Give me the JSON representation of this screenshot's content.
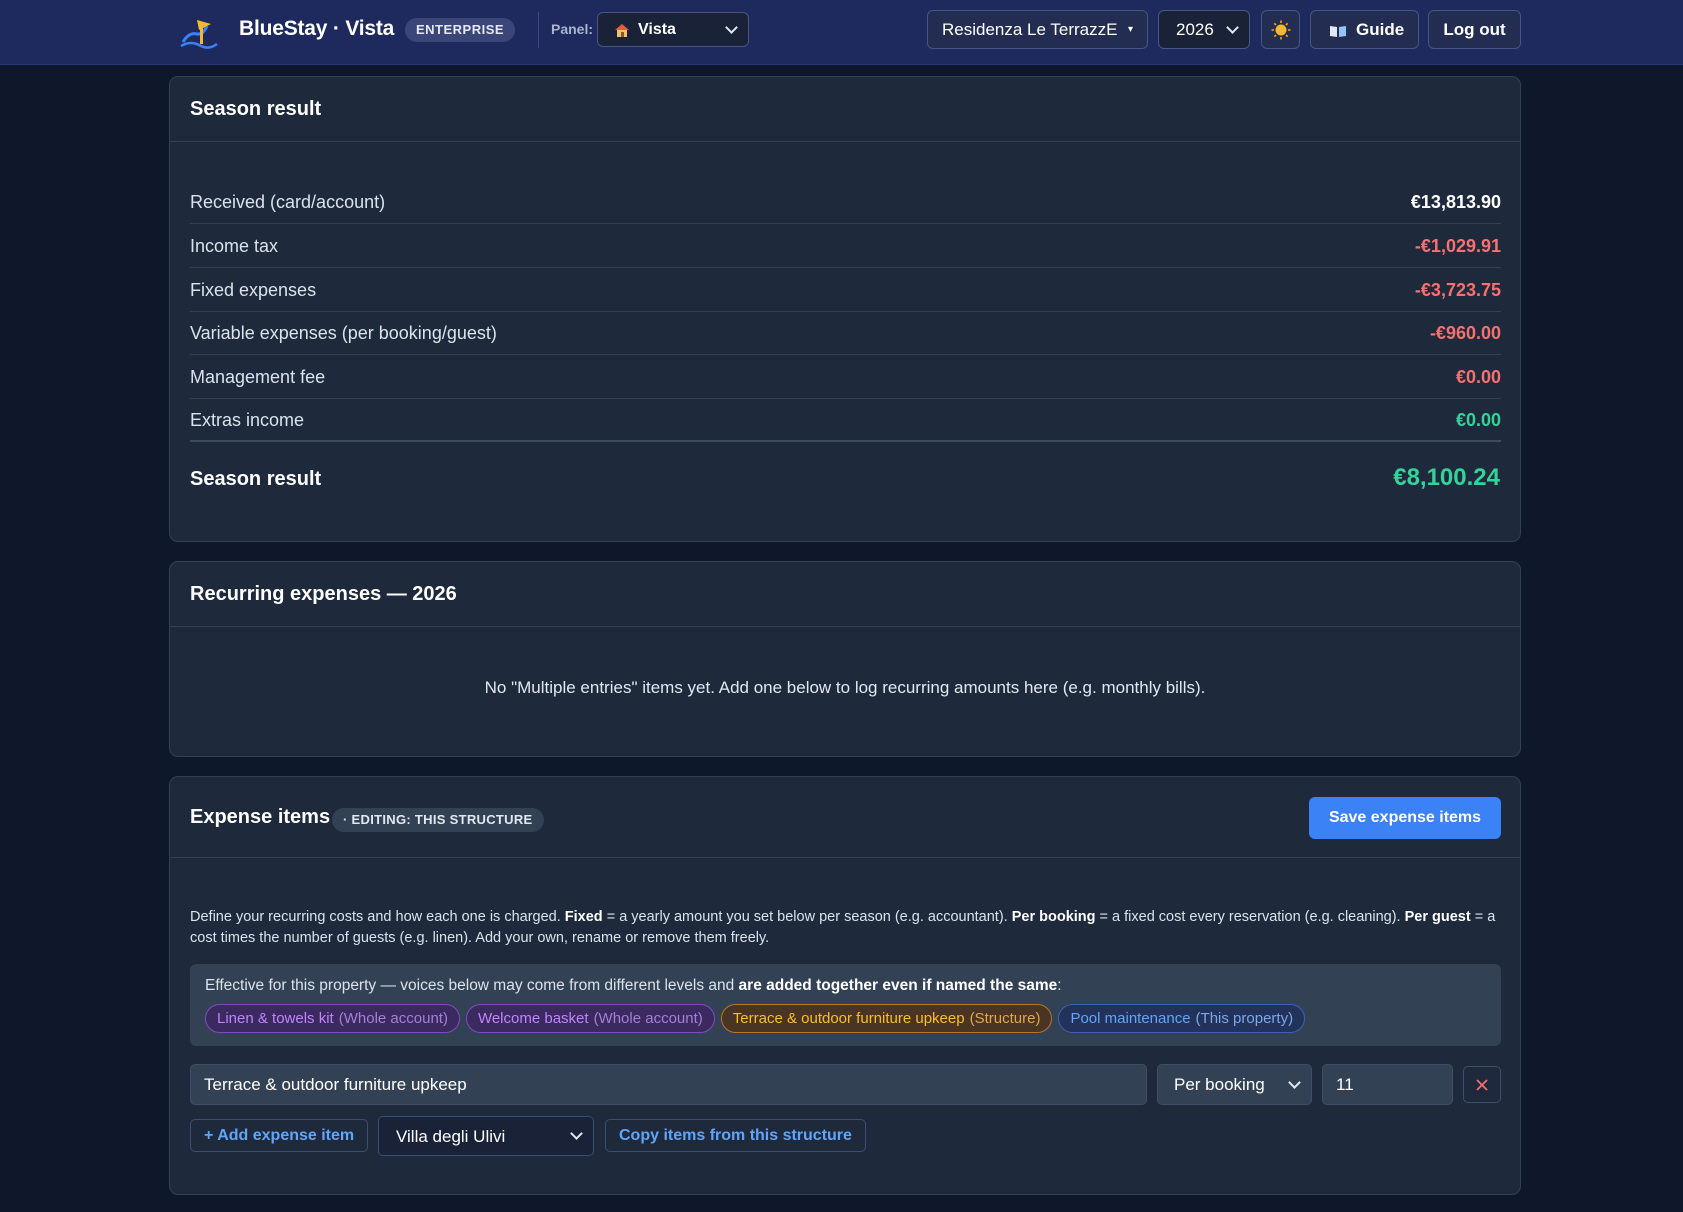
{
  "header": {
    "brand": "BlueStay · Vista",
    "edition_badge": "ENTERPRISE",
    "panel_label": "Panel:",
    "panel_value": "Vista",
    "property": "Residenza Le TerrazzE",
    "year": "2026",
    "guide_label": "Guide",
    "logout_label": "Log out"
  },
  "season": {
    "title": "Season result",
    "rows": [
      {
        "label": "Received (card/account)",
        "amount": "€13,813.90"
      },
      {
        "label": "Income tax",
        "amount": "-€1,029.91"
      },
      {
        "label": "Fixed expenses",
        "amount": "-€3,723.75"
      },
      {
        "label": "Variable expenses (per booking/guest)",
        "amount": "-€960.00"
      },
      {
        "label": "Management fee",
        "amount": "€0.00"
      },
      {
        "label": "Extras income",
        "amount": "€0.00"
      }
    ],
    "total_label": "Season result",
    "total_amount": "€8,100.24"
  },
  "recurring": {
    "title": "Recurring expenses — 2026",
    "empty_text": "No \"Multiple entries\" items yet. Add one below to log recurring amounts here (e.g. monthly bills)."
  },
  "expenses": {
    "title": "Expense items",
    "editing_badge": "· EDITING: THIS STRUCTURE",
    "save_label": "Save expense items",
    "desc": {
      "p1": "Define your recurring costs and how each one is charged. ",
      "fixed": "Fixed",
      "p2": " = a yearly amount you set below per season (e.g. accountant). ",
      "per_booking": "Per booking",
      "p3": " = a fixed cost every reservation (e.g. cleaning). ",
      "per_guest": "Per guest",
      "p4": " = a cost times the number of guests (e.g. linen). Add your own, rename or remove them freely."
    },
    "effective": {
      "intro": "Effective for this property — voices below may come from different levels and ",
      "intro_bold": "are added together even if named the same",
      "intro_end": ":",
      "pills": [
        {
          "name": "Linen & towels kit",
          "level": "(Whole account)"
        },
        {
          "name": "Welcome basket",
          "level": "(Whole account)"
        },
        {
          "name": "Terrace & outdoor furniture upkeep",
          "level": "(Structure)"
        },
        {
          "name": "Pool maintenance",
          "level": "(This property)"
        }
      ]
    },
    "item": {
      "name": "Terrace & outdoor furniture upkeep",
      "mode": "Per booking",
      "amount": "11"
    },
    "add_label": "+ Add expense item",
    "source_structure": "Villa degli Ulivi",
    "copy_label": "Copy items from this structure"
  },
  "colors": {
    "topbar": "#1e2a5e",
    "background": "#0f172a",
    "card": "#1e293b",
    "accent": "#3b82f6",
    "positive": "#34d399",
    "negative": "#f87171"
  }
}
